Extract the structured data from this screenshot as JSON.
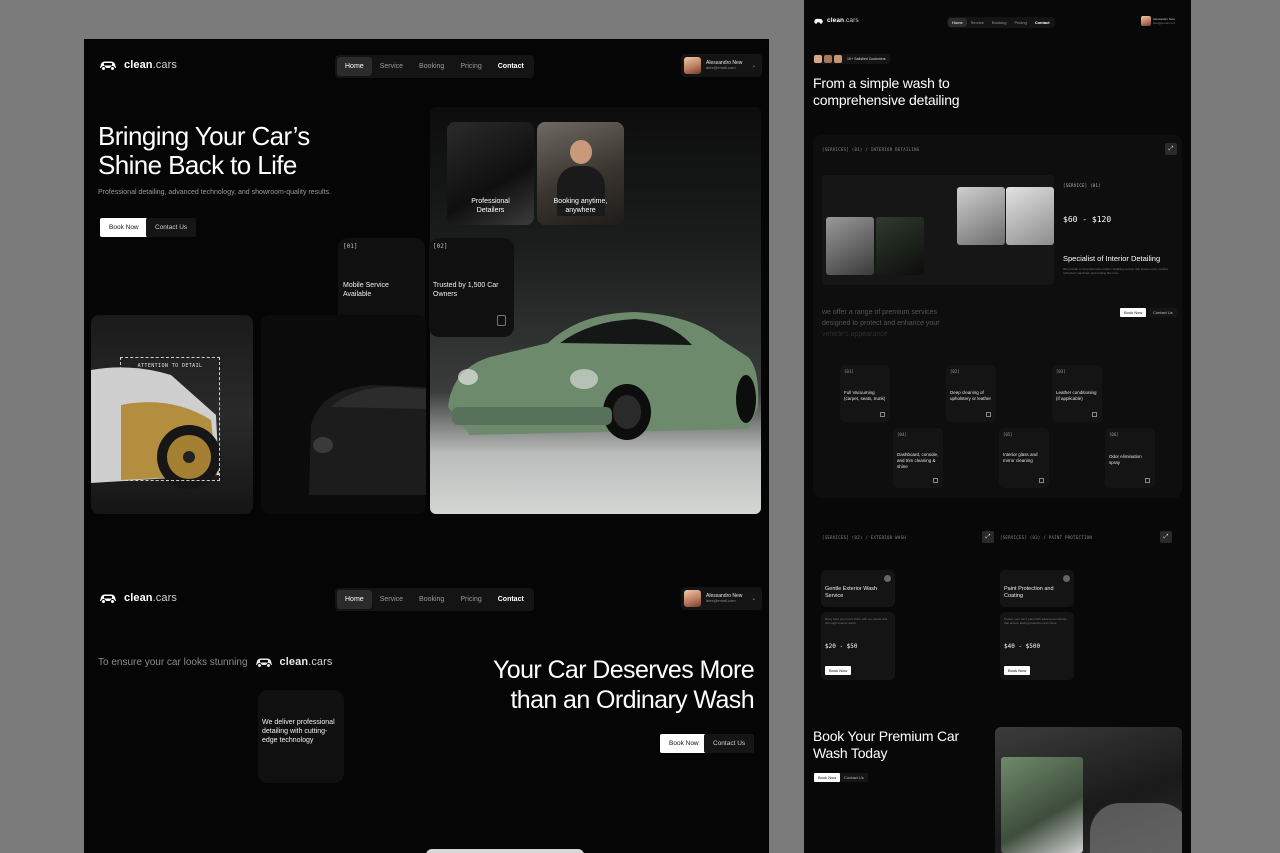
{
  "brand": {
    "name_bold": "clean",
    "name_light": ".cars"
  },
  "nav": [
    "Home",
    "Service",
    "Booking",
    "Pricing",
    "Contact"
  ],
  "user": {
    "name": "Alessandro New",
    "email": "alex@email.com"
  },
  "hero": {
    "title_line1": "Bringing Your Car’s",
    "title_line2": "Shine Back to Life",
    "subtitle": "Professional detailing, advanced technology, and showroom-quality results.",
    "book_label": "Book Now",
    "contact_label": "Contact Us"
  },
  "photos": {
    "interior_caption_1": "Professional",
    "interior_caption_2": "Detailers",
    "booking_caption_1": "Booking anytime,",
    "booking_caption_2": "anywhere",
    "attention": "ATTENTION TO DETAIL"
  },
  "tiles": [
    {
      "num": "[01]",
      "line1": "Mobile Service",
      "line2": "Available"
    },
    {
      "num": "[02]",
      "line1": "Trusted by 1,500 Car",
      "line2": "Owners"
    }
  ],
  "section2": {
    "ensure": "To ensure your car looks stunning",
    "deliver_1": "We deliver professional",
    "deliver_2": "detailing with cutting-",
    "deliver_3": "edge technology",
    "title_line1": "Your Car Deserves More",
    "title_line2": "than an Ordinary Wash",
    "book_label": "Book Now",
    "contact_label": "Contact Us"
  },
  "right": {
    "satisfied": "1K+ Satisfied Customers",
    "title_line1": "From a simple wash to",
    "title_line2": "comprehensive detailing",
    "interior_tag": "[SERVICES] (01) / INTERIOR DETAILING",
    "interior_num": "[SERVICE] (01)",
    "interior_price": "$60 - $120",
    "interior_title": "Specialist of Interior Detailing",
    "interior_desc": "We provide a comprehensive interior detailing service that leaves every surface refreshed, sanitized, and looking like new.",
    "offer_1": "we offer a range of premium services",
    "offer_2": "designed to protect and enhance your",
    "offer_3": "vehicle's appearance",
    "book_label": "Book Now",
    "contact_label": "Contact Us",
    "services": [
      {
        "num": "[01]",
        "text": "Full Vacuuming (carpet, seats, trunk)"
      },
      {
        "num": "[02]",
        "text": "Deep cleaning of upholstery or leather"
      },
      {
        "num": "[03]",
        "text": "Leather conditioning (if applicable)"
      },
      {
        "num": "[04]",
        "text": "Dashboard, console, and trim cleaning & shine"
      },
      {
        "num": "[05]",
        "text": "Interior glass and mirror cleaning"
      },
      {
        "num": "[06]",
        "text": "Odor elimination spray"
      }
    ],
    "exterior_tag": "[SERVICES] (02) / EXTERIOR WASH",
    "paint_tag": "[SERVICES] (03) / PAINT PROTECTION",
    "exterior_title": "Gentle Exterior Wash Service",
    "exterior_desc": "Bring back your car's shine with our gentle and thorough exterior wash.",
    "exterior_price": "$20 - $50",
    "paint_title": "Paint Protection and Coating",
    "paint_desc": "Protect your car's paint with advanced coatings that ensure lasting protection and shine.",
    "paint_price": "$40 - $500",
    "cta_line1": "Book Your Premium Car",
    "cta_line2": "Wash Today"
  }
}
